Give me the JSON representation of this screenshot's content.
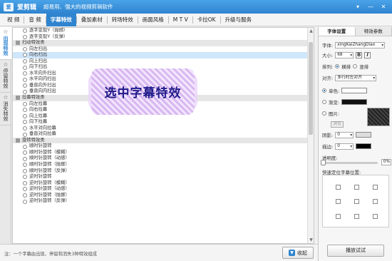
{
  "app": {
    "logo_text": "爱",
    "title": "爱剪辑",
    "subtitle": "超易用、强大的视频剪辑软件",
    "window_buttons": [
      "▾",
      "—",
      "✕"
    ]
  },
  "menu": [
    "视 频",
    "音 频",
    "字幕特效",
    "叠加素材",
    "转场特效",
    "画面风格",
    "M T V",
    "卡拉OK",
    "升级与服务"
  ],
  "menu_active": 2,
  "side_tabs": [
    {
      "icon": "☆",
      "label": "出现特效"
    },
    {
      "icon": "☆",
      "label": "停留特效"
    },
    {
      "icon": "☆",
      "label": "消失特效"
    }
  ],
  "effect_list": [
    {
      "type": "item",
      "label": "逐字变现Y（抛掷）"
    },
    {
      "type": "item",
      "label": "逐字变现Y（反弹）"
    },
    {
      "type": "cat",
      "label": "扫动特效类"
    },
    {
      "type": "item",
      "label": "向左扫出"
    },
    {
      "type": "item",
      "label": "向右扫出",
      "selected": true
    },
    {
      "type": "item",
      "label": "向上扫出"
    },
    {
      "type": "item",
      "label": "向下扫出"
    },
    {
      "type": "item",
      "label": "水平向外扫出"
    },
    {
      "type": "item",
      "label": "水平向内扫出"
    },
    {
      "type": "item",
      "label": "垂直向外扫出"
    },
    {
      "type": "item",
      "label": "垂直向内扫出"
    },
    {
      "type": "cat",
      "label": "拉幕特效类"
    },
    {
      "type": "item",
      "label": "向左拉幕"
    },
    {
      "type": "item",
      "label": "向右拉幕"
    },
    {
      "type": "item",
      "label": "向上拉幕"
    },
    {
      "type": "item",
      "label": "向下拉幕"
    },
    {
      "type": "item",
      "label": "水平对向拉幕"
    },
    {
      "type": "item",
      "label": "垂直对向拉幕"
    },
    {
      "type": "cat",
      "label": "旋转特效类"
    },
    {
      "type": "item",
      "label": "顺时针旋转"
    },
    {
      "type": "item",
      "label": "顺时针旋转（模糊）"
    },
    {
      "type": "item",
      "label": "顺时针旋转（动感）"
    },
    {
      "type": "item",
      "label": "顺时针旋转（抛掷）"
    },
    {
      "type": "item",
      "label": "顺时针旋转（反弹）"
    },
    {
      "type": "item",
      "label": "逆时针旋转"
    },
    {
      "type": "item",
      "label": "逆时针旋转（模糊）"
    },
    {
      "type": "item",
      "label": "逆时针旋转（动感）"
    },
    {
      "type": "item",
      "label": "逆时针旋转（抛掷）"
    },
    {
      "type": "item",
      "label": "逆时针旋转（反弹）"
    }
  ],
  "caption_overlay_text": "选中字幕特效",
  "bottom": {
    "note": "注：一个字幕由出现、停留和消失3种特效组成",
    "collapse_label": "收起",
    "collapse_icon": "▼"
  },
  "right_panel": {
    "tabs": [
      "字体设置",
      "特效参数"
    ],
    "font_label": "字体:",
    "font_value": "xingKaiZhangDiao",
    "size_label": "大小:",
    "size_value": "68",
    "bold": "B",
    "italic": "I",
    "layout_label": "排列:",
    "horizontal": "横排",
    "vertical": "竖排",
    "align_label": "对齐:",
    "align_value": "多行时左对齐",
    "solid_color": "单色:",
    "gradient": "渐变:",
    "image": "图片:",
    "browse": "浏览",
    "shadow_label": "阴影:",
    "shadow_value": "0",
    "outline_label": "描边:",
    "outline_value": "0",
    "opacity_label": "透明度:",
    "opacity_value": "0%",
    "position_label": "快速定位字幕位置:",
    "preview_button": "播放试试"
  }
}
